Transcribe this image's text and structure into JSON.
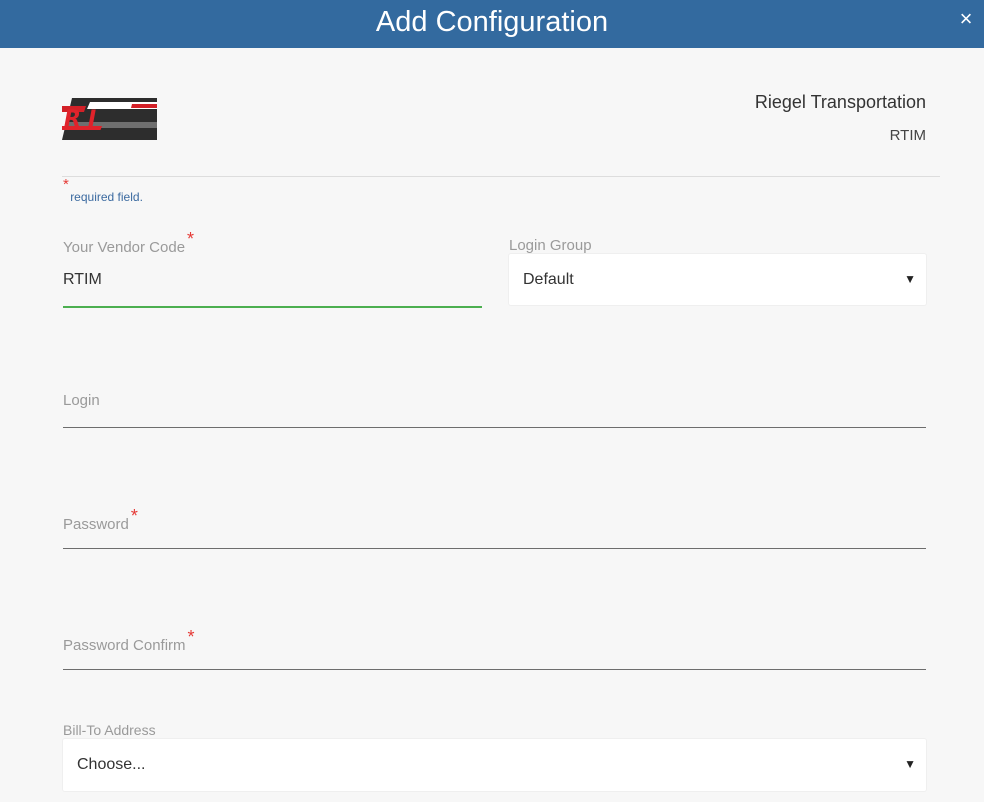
{
  "modal": {
    "title": "Add Configuration",
    "close_symbol": "×"
  },
  "company": {
    "name": "Riegel Transportation",
    "code": "RTIM",
    "logo_icon": "rti-logo"
  },
  "required_note": {
    "star": "*",
    "text": "required field."
  },
  "form": {
    "vendor_code": {
      "label": "Your Vendor Code",
      "required": "*",
      "value": "RTIM"
    },
    "login_group": {
      "label": "Login Group",
      "value": "Default",
      "caret": "▼"
    },
    "login": {
      "label": "Login",
      "value": ""
    },
    "password": {
      "label": "Password",
      "required": "*",
      "value": ""
    },
    "password_confirm": {
      "label": "Password Confirm",
      "required": "*",
      "value": ""
    },
    "bill_to": {
      "label": "Bill-To Address",
      "value": "Choose...",
      "caret": "▼"
    }
  },
  "colors": {
    "header_bg": "#336a9f",
    "required_star": "#e53935",
    "active_underline": "#4caf50",
    "note_text": "#3b6aa0"
  }
}
